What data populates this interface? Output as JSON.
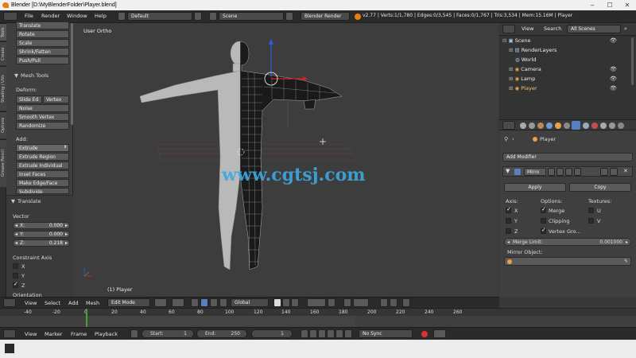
{
  "window": {
    "title": "Blender [D:\\MyBlenderFolder\\Player.blend]",
    "minimize": "–",
    "maximize": "☐",
    "close": "✕"
  },
  "menubar": {
    "items": [
      "File",
      "Render",
      "Window",
      "Help"
    ],
    "layout": "Default",
    "scene": "Scene",
    "engine": "Blender Render",
    "stats": "v2.77 | Verts:1/1,780 | Edges:0/3,545 | Faces:0/1,767 | Tris:3,534 | Mem:15.16M | Player"
  },
  "toolshelf": {
    "tabs": [
      "Tools",
      "Create",
      "Shading / UVs",
      "Options",
      "Grease Pencil"
    ],
    "transform_buttons": [
      "Translate",
      "Rotate",
      "Scale",
      "Shrink/Fatten",
      "Push/Pull"
    ],
    "mesh_tools_header": "Mesh Tools",
    "deform_label": "Deform:",
    "slide_edge": "Slide Ed",
    "vertex": "Vertex",
    "deform_buttons": [
      "Noise",
      "Smooth Vertex",
      "Randomize"
    ],
    "add_label": "Add:",
    "extrude": "Extrude",
    "add_buttons": [
      "Extrude Region",
      "Extrude Individual",
      "Inset Faces",
      "Make Edge/Face",
      "Subdivide"
    ]
  },
  "operator": {
    "header": "Translate",
    "vector_label": "Vector",
    "x_label": "X:",
    "x_value": "0.000",
    "y_label": "Y:",
    "y_value": "0.000",
    "z_label": "Z:",
    "z_value": "0.218",
    "constraint_label": "Constraint Axis",
    "axes": [
      "X",
      "Y",
      "Z"
    ],
    "axes_checked": [
      false,
      false,
      true
    ],
    "orientation_label": "Orientation"
  },
  "viewport": {
    "view_label": "User Ortho",
    "object_label": "(1) Player",
    "watermark": "www.cgtsj.com"
  },
  "outliner": {
    "view": "View",
    "search": "Search",
    "filter": "All Scenes",
    "items": [
      "Scene",
      "RenderLayers",
      "World",
      "Camera",
      "Lamp",
      "Player"
    ]
  },
  "properties": {
    "breadcrumb": "Player",
    "add_modifier": "Add Modifier",
    "modifier_name": "Mirro",
    "apply": "Apply",
    "copy": "Copy",
    "axis_label": "Axis:",
    "options_label": "Options:",
    "textures_label": "Textures:",
    "axis_x": "X",
    "axis_y": "Y",
    "axis_z": "Z",
    "merge": "Merge",
    "clipping": "Clipping",
    "vertex_groups": "Vertex Gro...",
    "tex_u": "U",
    "tex_v": "V",
    "merge_limit_label": "Merge Limit:",
    "merge_limit_value": "0.001000",
    "mirror_object_label": "Mirror Object:"
  },
  "viewport_header": {
    "menus": [
      "View",
      "Select",
      "Add",
      "Mesh"
    ],
    "mode": "Edit Mode",
    "orientation": "Global"
  },
  "timeline": {
    "ticks": [
      "-40",
      "-20",
      "0",
      "20",
      "40",
      "60",
      "80",
      "100",
      "120",
      "140",
      "160",
      "180",
      "200",
      "220",
      "240",
      "260"
    ],
    "current_frame_marker": "0"
  },
  "timeline_header": {
    "menus": [
      "View",
      "Marker",
      "Frame",
      "Playback"
    ],
    "start_label": "Start:",
    "start_value": "1",
    "end_label": "End:",
    "end_value": "250",
    "current_frame": "1",
    "sync": "No Sync"
  },
  "colors": {
    "accent_blue": "#5680c2",
    "orange": "#e87d0d",
    "header_dark": "#2b2b2b"
  }
}
